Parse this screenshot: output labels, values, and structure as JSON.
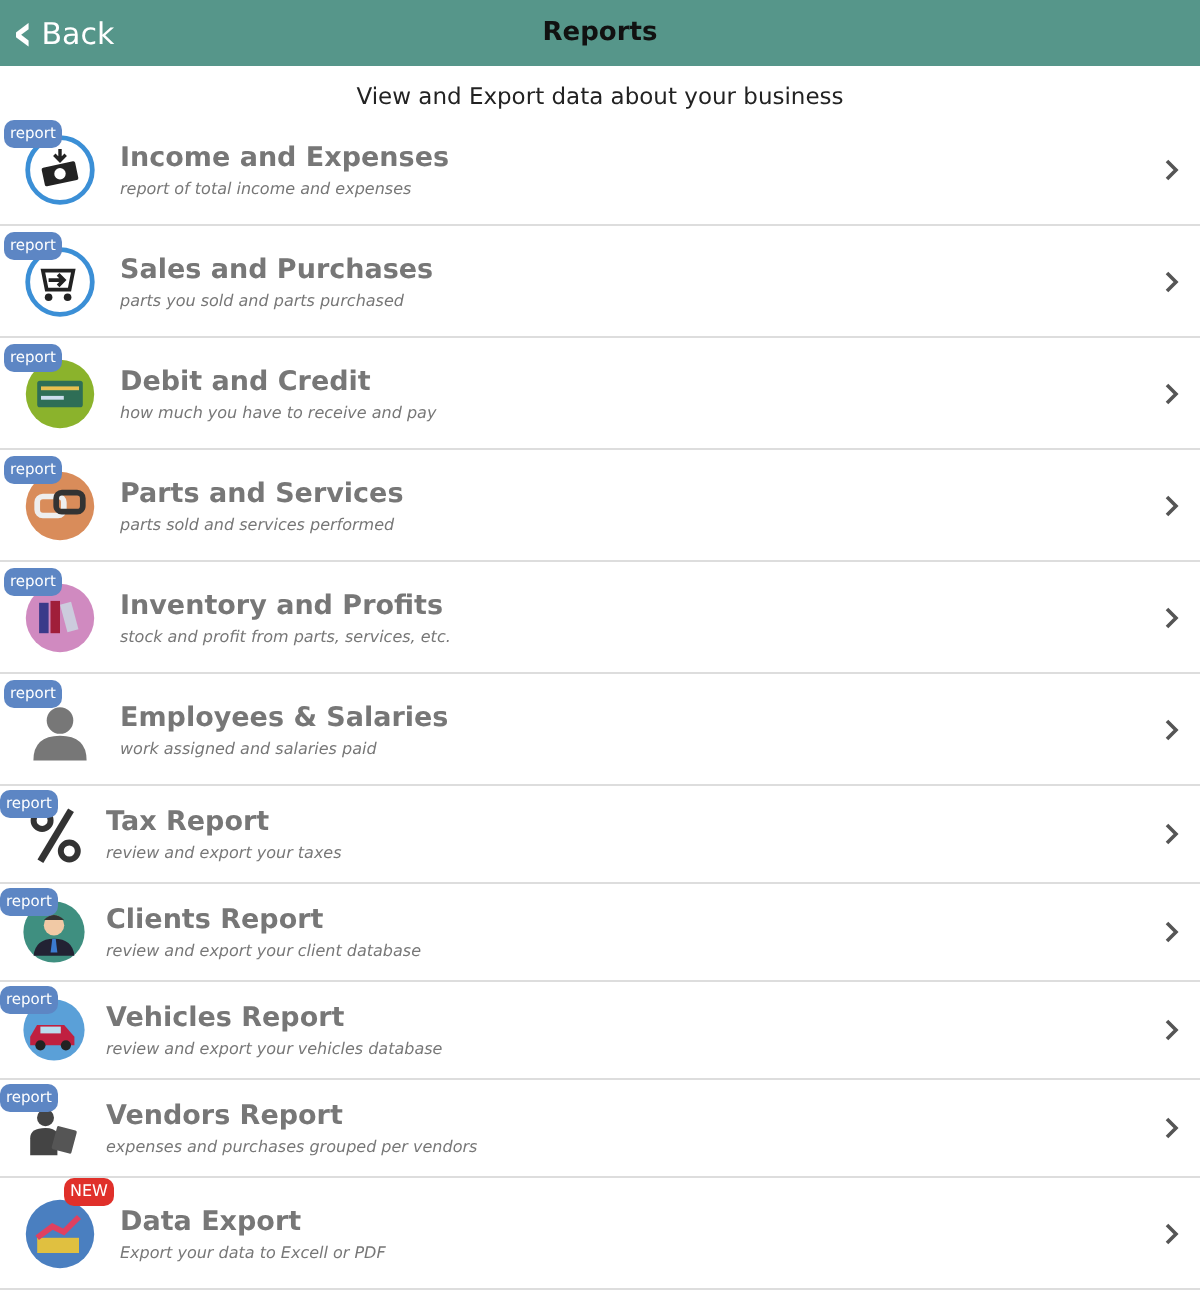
{
  "header": {
    "back": {
      "icon": "‹",
      "label": "Back"
    },
    "title": "Reports"
  },
  "subtitle": "View and Export data about your business",
  "items": [
    {
      "kind": "money",
      "badge": {
        "kind": "report",
        "text": "report"
      },
      "title": "Income and Expenses",
      "description": "report of total income and expenses"
    },
    {
      "kind": "cart",
      "badge": {
        "kind": "report",
        "text": "report"
      },
      "title": "Sales and Purchases",
      "description": "parts you sold and parts purchased"
    },
    {
      "kind": "card",
      "badge": {
        "kind": "report",
        "text": "report"
      },
      "title": "Debit and Credit",
      "description": "how much you have to receive and pay"
    },
    {
      "kind": "link",
      "badge": {
        "kind": "report",
        "text": "report"
      },
      "title": "Parts and Services",
      "description": "parts sold and services performed"
    },
    {
      "kind": "binders",
      "badge": {
        "kind": "report",
        "text": "report"
      },
      "title": "Inventory and Profits",
      "description": "stock and profit from parts, services, etc."
    },
    {
      "kind": "person",
      "badge": {
        "kind": "report",
        "text": "report"
      },
      "title": "Employees & Salaries",
      "description": "work assigned and salaries paid"
    },
    {
      "kind": "percent",
      "badge": {
        "kind": "report",
        "text": "report"
      },
      "title": "Tax Report",
      "description": "review and export your taxes"
    },
    {
      "kind": "client",
      "badge": {
        "kind": "report",
        "text": "report"
      },
      "title": "Clients Report",
      "description": "review and export your client database"
    },
    {
      "kind": "car",
      "badge": {
        "kind": "report",
        "text": "report"
      },
      "title": "Vehicles Report",
      "description": "review and export your vehicles database"
    },
    {
      "kind": "vendor",
      "badge": {
        "kind": "report",
        "text": "report"
      },
      "title": "Vendors Report",
      "description": "expenses and purchases grouped per vendors"
    },
    {
      "kind": "chart",
      "badge": {
        "kind": "new",
        "text": "NEW"
      },
      "title": "Data Export",
      "description": "Export your data to Excell or PDF"
    }
  ]
}
